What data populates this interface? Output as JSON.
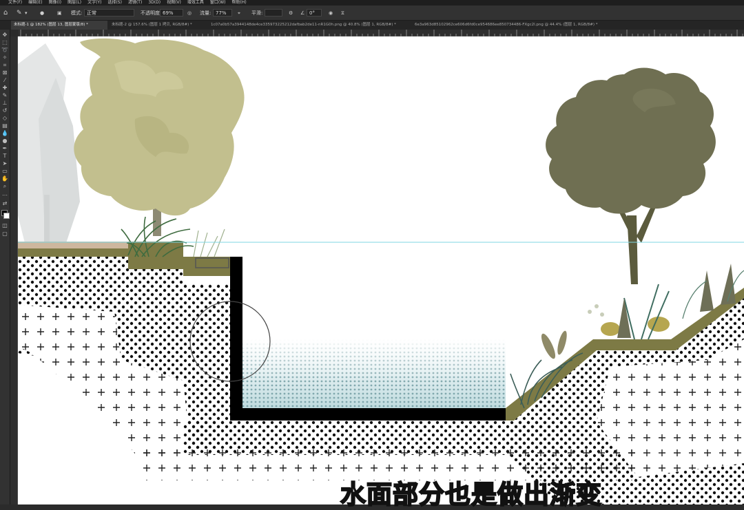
{
  "menubar": {
    "items": [
      "文件(F)",
      "编辑(E)",
      "图像(I)",
      "图层(L)",
      "文字(Y)",
      "选择(S)",
      "滤镜(T)",
      "3D(D)",
      "视图(V)",
      "增效工具",
      "窗口(W)",
      "帮助(H)"
    ]
  },
  "options": {
    "mode_label": "模式:",
    "mode_value": "正常",
    "opacity_label": "不透明度:",
    "opacity_value": "69%",
    "flow_label": "流量:",
    "flow_value": "77%",
    "smooth_label": "平滑:",
    "angle_value": "0°"
  },
  "tabs": [
    {
      "label": "未标题-1 @ 182% (图层 13, 图层蒙版/8) *"
    },
    {
      "label": "未标题-2 @ 157.6% (图层 1 拷贝, RGB/8#) *"
    },
    {
      "label": "1c07a0b57a3944148de4ce335973225212dafbab2de11-nR1G0h.png @ 40.8% (图层 1, RGB/8#) *"
    },
    {
      "label": "6e3a963d85102962ce606d6fd0ce954686ee850734486-FXgc2l.png @ 44.4% (图层 1, RGB/8#) *"
    }
  ],
  "caption": {
    "text": "水面部分也是做出渐变"
  },
  "colors": {
    "tree_light": "#c2bf8e",
    "tree_dark": "#6f6f52",
    "ground": "#7d7a45",
    "water": "#bfdadd",
    "guide": "#7fd7e3",
    "wall": "#000000"
  }
}
